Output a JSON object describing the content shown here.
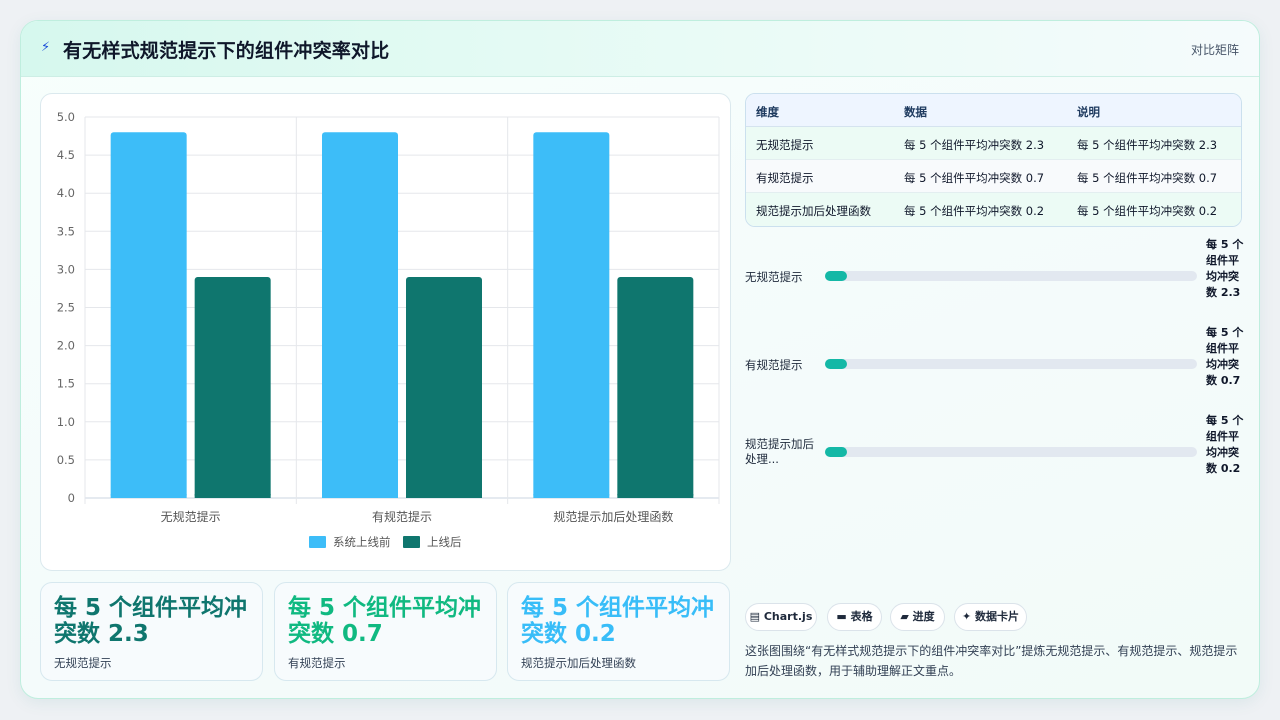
{
  "header": {
    "icon": "lightning-icon",
    "title": "有无样式规范提示下的组件冲突率对比",
    "right_label": "对比矩阵"
  },
  "chart_data": {
    "type": "bar",
    "categories": [
      "无规范提示",
      "有规范提示",
      "规范提示加后处理函数"
    ],
    "series": [
      {
        "name": "系统上线前",
        "values": [
          4.8,
          4.8,
          4.8
        ],
        "color": "#3dbdf8"
      },
      {
        "name": "上线后",
        "values": [
          2.9,
          2.9,
          2.9
        ],
        "color": "#0f766e"
      }
    ],
    "ylim": [
      0,
      5
    ],
    "yticks": [
      "0",
      "0.5",
      "1.0",
      "1.5",
      "2.0",
      "2.5",
      "3.0",
      "3.5",
      "4.0",
      "4.5",
      "5.0"
    ],
    "grid": true,
    "legend_position": "bottom"
  },
  "table": {
    "headers": [
      "维度",
      "数据",
      "说明"
    ],
    "rows": [
      [
        "无规范提示",
        "每 5 个组件平均冲突数 2.3",
        "每 5 个组件平均冲突数 2.3"
      ],
      [
        "有规范提示",
        "每 5 个组件平均冲突数 0.7",
        "每 5 个组件平均冲突数 0.7"
      ],
      [
        "规范提示加后处理函数",
        "每 5 个组件平均冲突数 0.2",
        "每 5 个组件平均冲突数 0.2"
      ]
    ]
  },
  "progress": [
    {
      "label": "无规范提示",
      "value_text": "每 5 个组件平均冲突数 2.3",
      "fraction": 0.06
    },
    {
      "label": "有规范提示",
      "value_text": "每 5 个组件平均冲突数 0.7",
      "fraction": 0.06
    },
    {
      "label": "规范提示加后处理函数",
      "display_label": "规范提示加后处理...",
      "value_text": "每 5 个组件平均冲突数 0.2",
      "fraction": 0.06
    }
  ],
  "stats": [
    {
      "value": "每 5 个组件平均冲突数 2.3",
      "label": "无规范提示",
      "color": "#0f766e"
    },
    {
      "value": "每 5 个组件平均冲突数 0.7",
      "label": "有规范提示",
      "color": "#10b981"
    },
    {
      "value": "每 5 个组件平均冲突数 0.2",
      "label": "规范提示加后处理函数",
      "color": "#38bdf8"
    }
  ],
  "tags": [
    {
      "icon": "chart-icon",
      "glyph": "▤",
      "label": "Chart.js"
    },
    {
      "icon": "table-icon",
      "glyph": "▬",
      "label": "表格"
    },
    {
      "icon": "progress-icon",
      "glyph": "▰",
      "label": "进度"
    },
    {
      "icon": "sparkle-icon",
      "glyph": "✦",
      "label": "数据卡片"
    }
  ],
  "summary": "这张图围绕“有无样式规范提示下的组件冲突率对比”提炼无规范提示、有规范提示、规范提示加后处理函数，用于辅助理解正文重点。"
}
